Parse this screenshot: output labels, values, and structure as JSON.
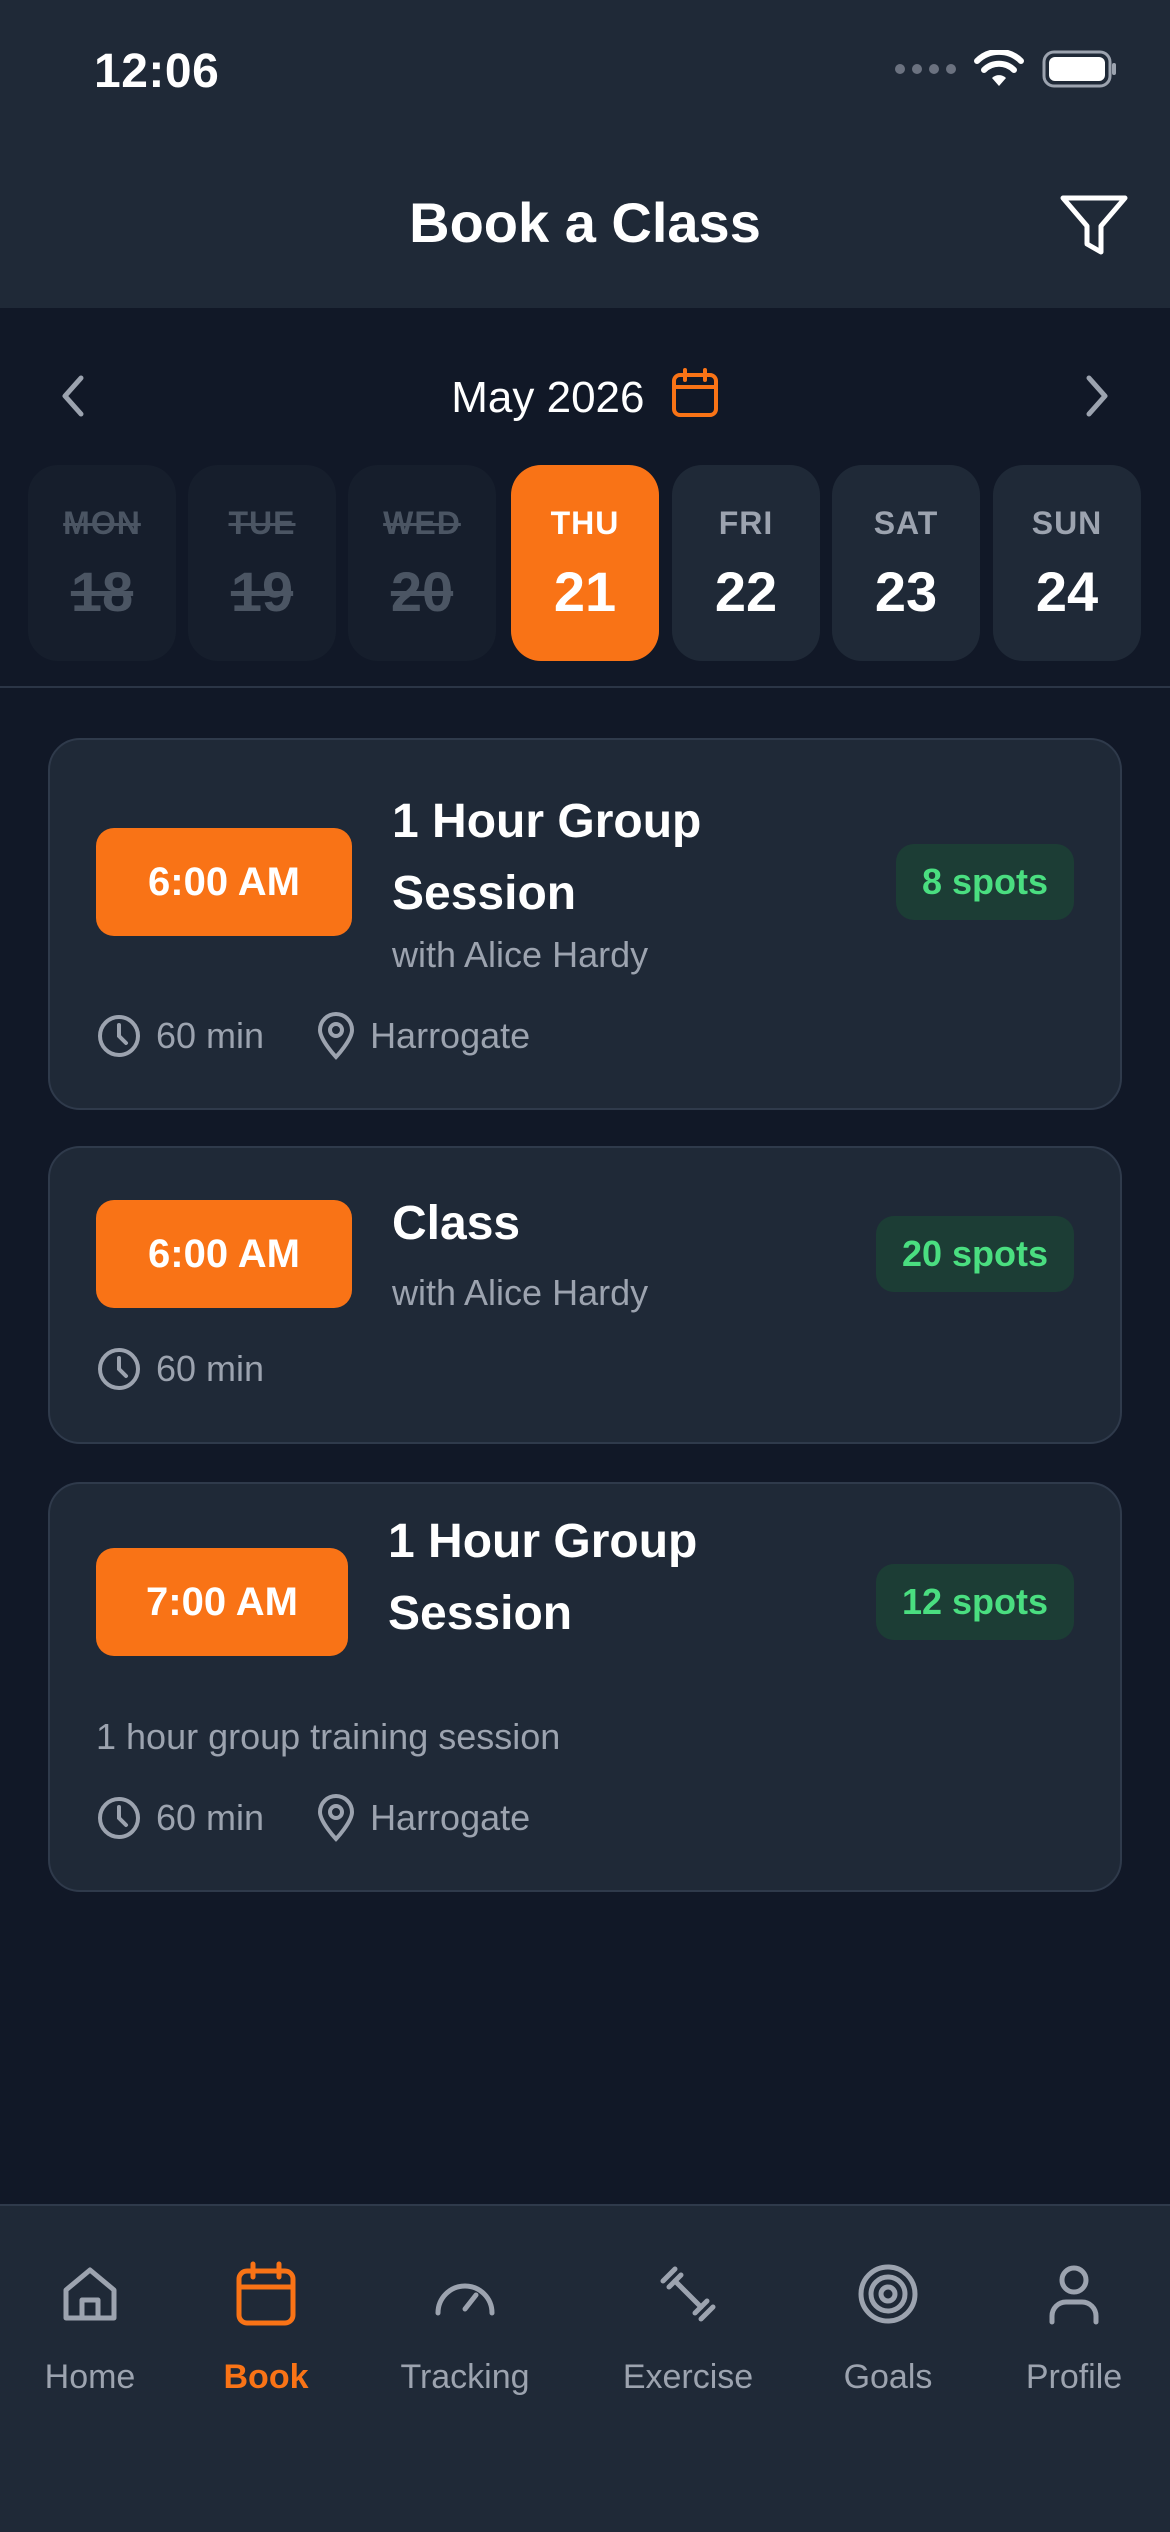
{
  "status_bar": {
    "time": "12:06"
  },
  "header": {
    "title": "Book a Class"
  },
  "calendar": {
    "month": "May 2026",
    "days": [
      {
        "name": "MON",
        "num": "18",
        "state": "past"
      },
      {
        "name": "TUE",
        "num": "19",
        "state": "past"
      },
      {
        "name": "WED",
        "num": "20",
        "state": "past"
      },
      {
        "name": "THU",
        "num": "21",
        "state": "active"
      },
      {
        "name": "FRI",
        "num": "22",
        "state": "normal"
      },
      {
        "name": "SAT",
        "num": "23",
        "state": "normal"
      },
      {
        "name": "SUN",
        "num": "24",
        "state": "normal"
      }
    ]
  },
  "classes": [
    {
      "time": "6:00 AM",
      "title_line1": "1 Hour Group",
      "title_line2": "Session",
      "instructor": "with Alice Hardy",
      "spots": "8 spots",
      "duration": "60 min",
      "location": "Harrogate"
    },
    {
      "time": "6:00 AM",
      "title_line1": "Class",
      "instructor": "with Alice Hardy",
      "spots": "20 spots",
      "duration": "60 min"
    },
    {
      "time": "7:00 AM",
      "title_line1": "1 Hour Group",
      "title_line2": "Session",
      "description": "1 hour group training session",
      "spots": "12 spots",
      "duration": "60 min",
      "location": "Harrogate"
    }
  ],
  "nav": {
    "items": [
      {
        "label": "Home",
        "icon": "home-icon"
      },
      {
        "label": "Book",
        "icon": "calendar-icon",
        "active": true
      },
      {
        "label": "Tracking",
        "icon": "gauge-icon"
      },
      {
        "label": "Exercise",
        "icon": "dumbbell-icon"
      },
      {
        "label": "Goals",
        "icon": "target-icon"
      },
      {
        "label": "Profile",
        "icon": "user-icon"
      }
    ]
  },
  "colors": {
    "accent": "#f97316",
    "background": "#111827",
    "surface": "#1f2937",
    "spots_text": "#4ade80",
    "spots_bg": "#1c3d35",
    "muted_text": "#9ca3af"
  }
}
